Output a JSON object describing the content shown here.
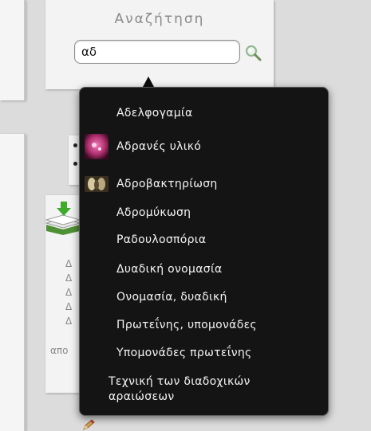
{
  "search": {
    "title": "Αναζήτηση",
    "query": "αδ",
    "icon": "magnifier-icon"
  },
  "dropdown": {
    "items": [
      {
        "label": "Αδελφογαμία"
      },
      {
        "label": "Αδρανές υλικό",
        "thumbnail": "pink-abstract-thumbnail"
      },
      {
        "label": "Αδροβακτηρίωση",
        "thumbnail": "leaf-photo-thumbnail"
      },
      {
        "label": "Αδρομύκωση"
      },
      {
        "label": "Ραδουλοσπόρια"
      },
      {
        "label": "Δυαδική ονομασία"
      },
      {
        "label": "Ονομασία, δυαδική"
      },
      {
        "label": "Πρωτεΐνης, υπομονάδες"
      },
      {
        "label": "Υπομονάδες πρωτεΐνης"
      },
      {
        "label": "Τεχνική των διαδοχικών αραιώσεων"
      }
    ]
  },
  "sidebar": {
    "letters": [
      "Δ",
      "Δ",
      "Δ",
      "Δ",
      "Δ"
    ],
    "truncated_word": "απο"
  },
  "colors": {
    "dropdown_bg": "#141414",
    "dropdown_text": "#f4f4f4",
    "panel_bg": "#f3f3f3",
    "page_bg": "#dcdcdc"
  }
}
